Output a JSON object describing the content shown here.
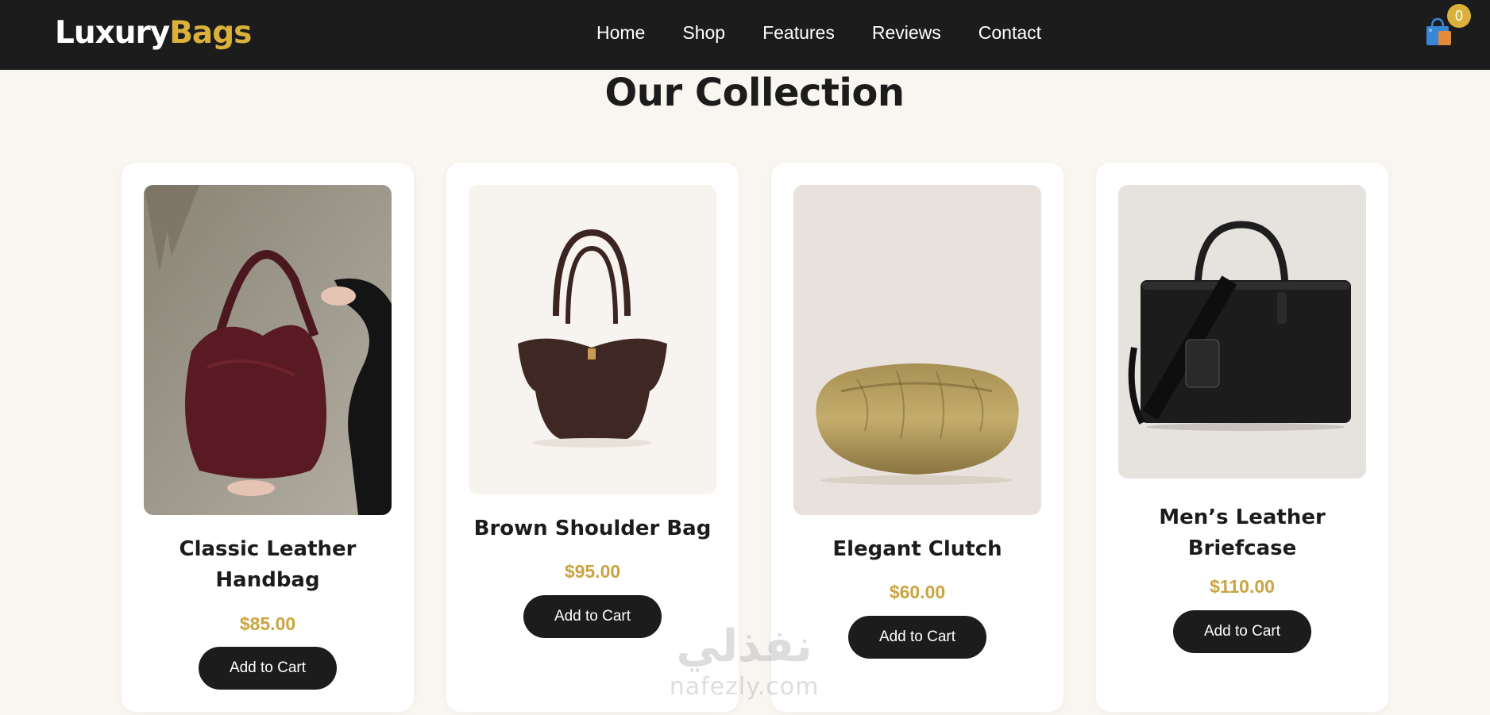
{
  "header": {
    "logo_part1": "Luxury",
    "logo_part2": "Bags",
    "nav": [
      {
        "label": "Home"
      },
      {
        "label": "Shop"
      },
      {
        "label": "Features"
      },
      {
        "label": "Reviews"
      },
      {
        "label": "Contact"
      }
    ],
    "cart_icon": "shopping-bag-icon",
    "cart_count": "0"
  },
  "main": {
    "title": "Our Collection",
    "products": [
      {
        "name": "Classic Leather Handbag",
        "price": "$85.00",
        "button": "Add to Cart"
      },
      {
        "name": "Brown Shoulder Bag",
        "price": "$95.00",
        "button": "Add to Cart"
      },
      {
        "name": "Elegant Clutch",
        "price": "$60.00",
        "button": "Add to Cart"
      },
      {
        "name": "Men’s Leather Briefcase",
        "price": "$110.00",
        "button": "Add to Cart"
      }
    ]
  },
  "watermark": {
    "arabic": "نفذلي",
    "latin": "nafezly.com"
  },
  "colors": {
    "nav_bg": "#1c1c1c",
    "accent": "#d9b13b",
    "price": "#c9a441",
    "page_bg": "#f9f6f1"
  }
}
